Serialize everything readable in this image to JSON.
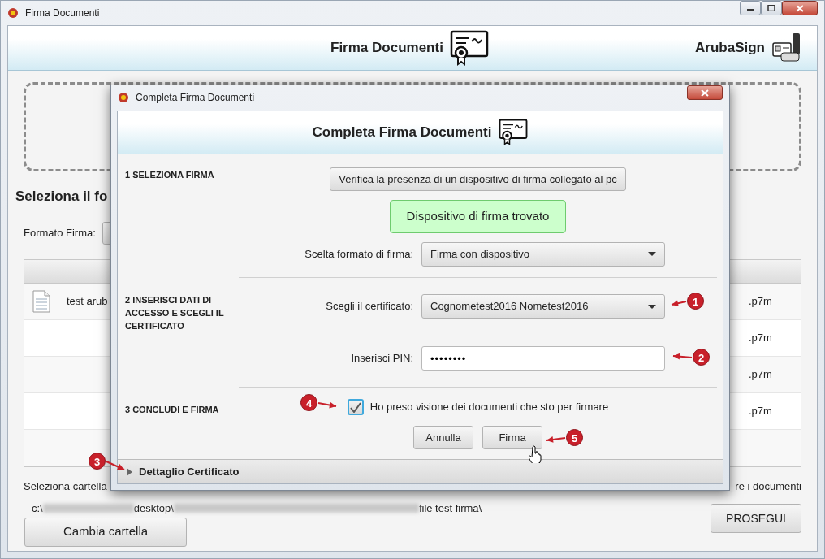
{
  "window": {
    "title": "Firma Documenti"
  },
  "header": {
    "title": "Firma Documenti",
    "brand": "ArubaSign"
  },
  "section_title": "Seleziona il fo",
  "format_label": "Formato Firma:",
  "table": {
    "rows": [
      {
        "file": "test arub",
        "ext": ".p7m"
      },
      {
        "ext": ".p7m"
      },
      {
        "ext": ".p7m"
      },
      {
        "ext": ".p7m"
      }
    ]
  },
  "folder": {
    "label": "Seleziona cartella",
    "label_end": "re i documenti",
    "path": [
      {
        "kind": "text",
        "text": "c:\\"
      },
      {
        "kind": "redacted"
      },
      {
        "kind": "text",
        "text": "desktop\\"
      },
      {
        "kind": "redacted"
      },
      {
        "kind": "text",
        "text": "file test firma\\"
      }
    ],
    "change_button": "Cambia cartella"
  },
  "proceed_button": "PROSEGUI",
  "dialog": {
    "title": "Completa Firma Documenti",
    "header": "Completa Firma Documenti",
    "step1": {
      "label": "1 SELEZIONA FIRMA",
      "verify_button": "Verifica la presenza di un dispositivo di firma collegato al pc",
      "status": "Dispositivo di firma trovato",
      "format_label": "Scelta formato di firma:",
      "format_value": "Firma con dispositivo"
    },
    "step2": {
      "label": "2 INSERISCI DATI DI ACCESSO E SCEGLI IL CERTIFICATO",
      "cert_label": "Scegli il certificato:",
      "cert_value": "Cognometest2016 Nometest2016",
      "pin_label": "Inserisci PIN:",
      "pin_value": "••••••••"
    },
    "step3": {
      "label": "3 CONCLUDI E FIRMA",
      "checkbox_label": "Ho preso visione dei documenti che sto per firmare",
      "checked": true,
      "cancel_button": "Annulla",
      "sign_button": "Firma"
    },
    "details": {
      "label": "Dettaglio Certificato",
      "expanded": false
    }
  },
  "annotations": [
    {
      "label": "1"
    },
    {
      "label": "2"
    },
    {
      "label": "3"
    },
    {
      "label": "4"
    },
    {
      "label": "5"
    }
  ]
}
